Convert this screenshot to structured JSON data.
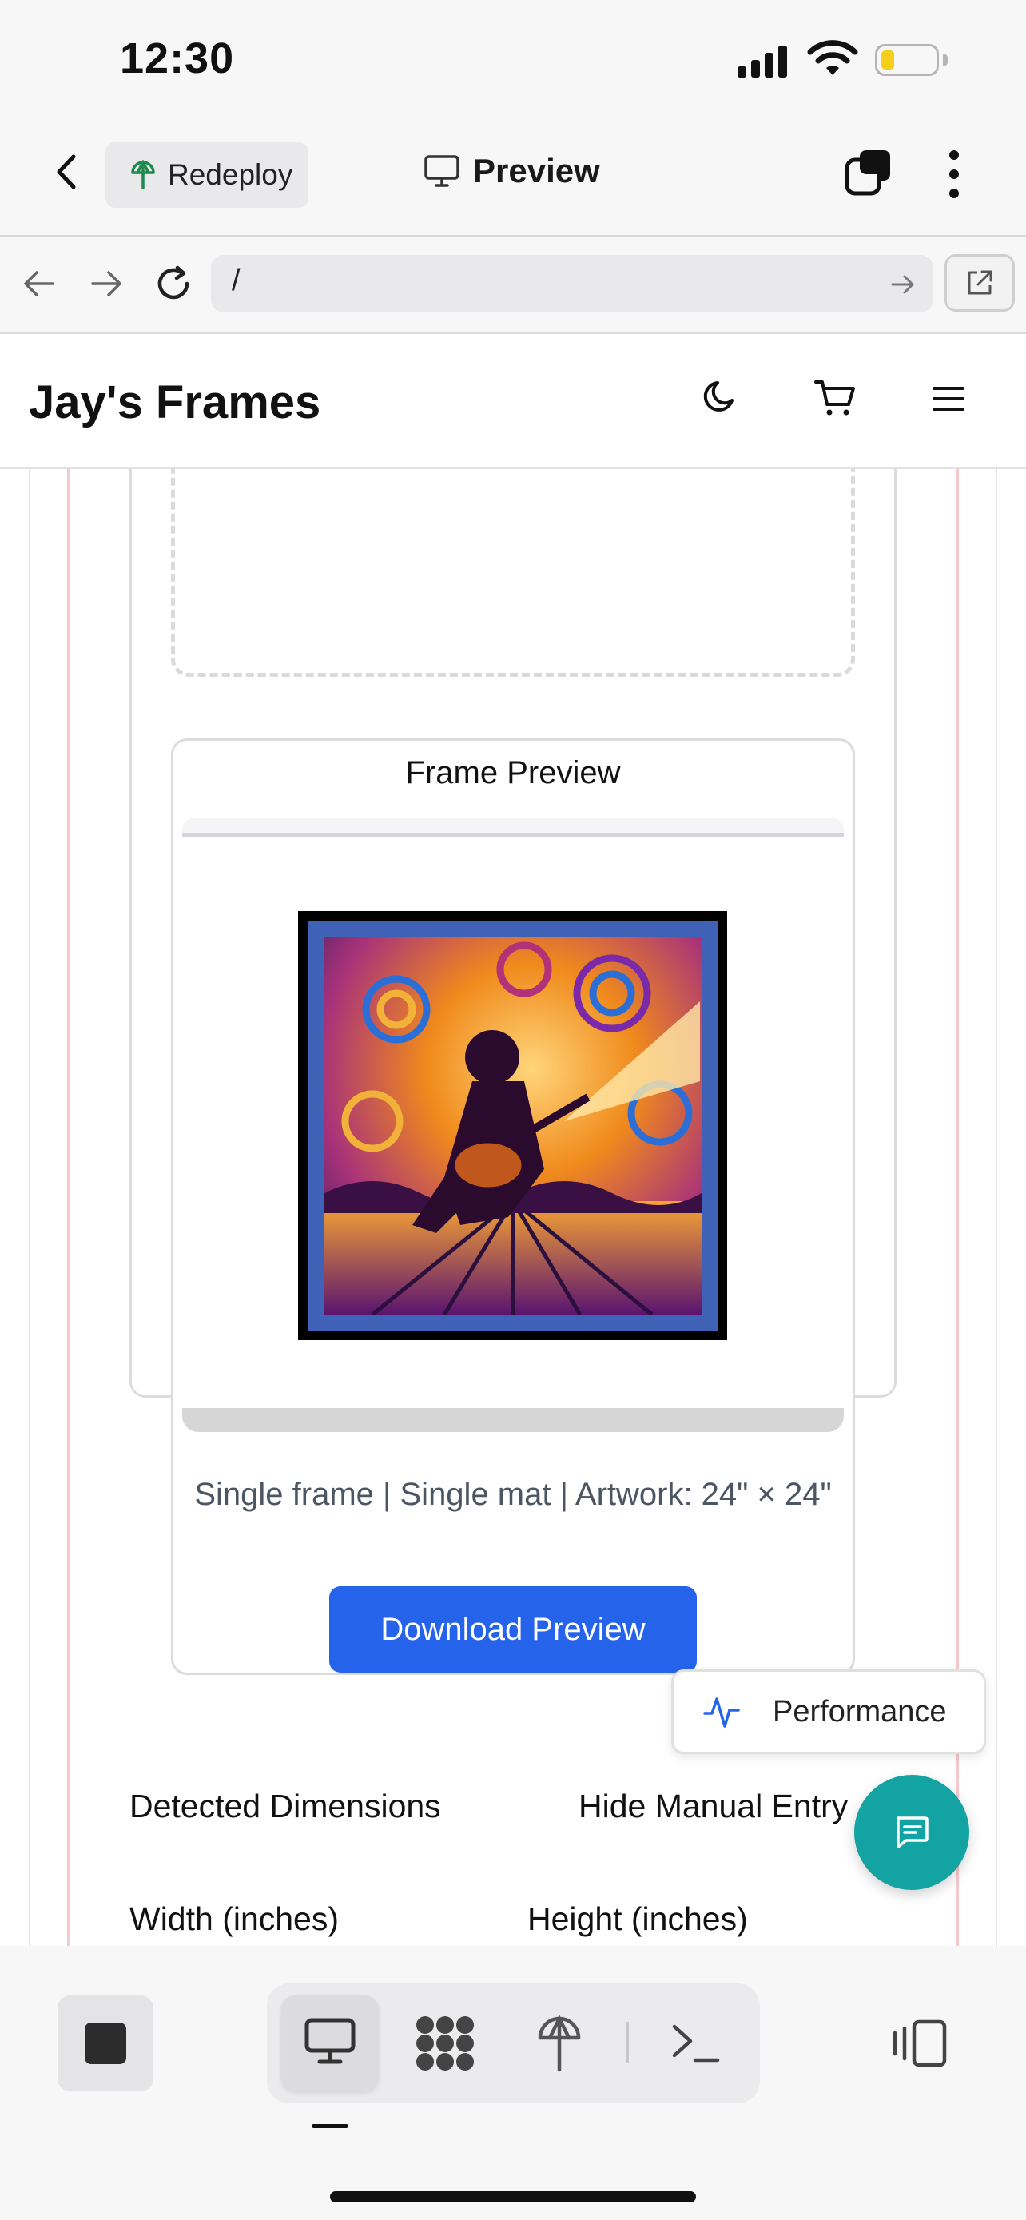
{
  "status_bar": {
    "time": "12:30"
  },
  "top_bar": {
    "redeploy_label": "Redeploy",
    "title": "Preview"
  },
  "url_bar": {
    "path": "/"
  },
  "site": {
    "title": "Jay's Frames"
  },
  "frame_preview": {
    "heading": "Frame Preview",
    "caption": "Single frame | Single mat | Artwork: 24\" × 24\"",
    "download_label": "Download Preview",
    "mat_color": "#4062b6",
    "frame_color": "#000000"
  },
  "dimensions": {
    "detected_label": "Detected Dimensions",
    "toggle_label": "Hide Manual Entry",
    "width_label": "Width (inches)",
    "height_label": "Height (inches)"
  },
  "floating": {
    "performance_label": "Performance"
  },
  "colors": {
    "accent": "#2563eb",
    "fab": "#14a3a3",
    "guide": "#f7c8cd"
  }
}
